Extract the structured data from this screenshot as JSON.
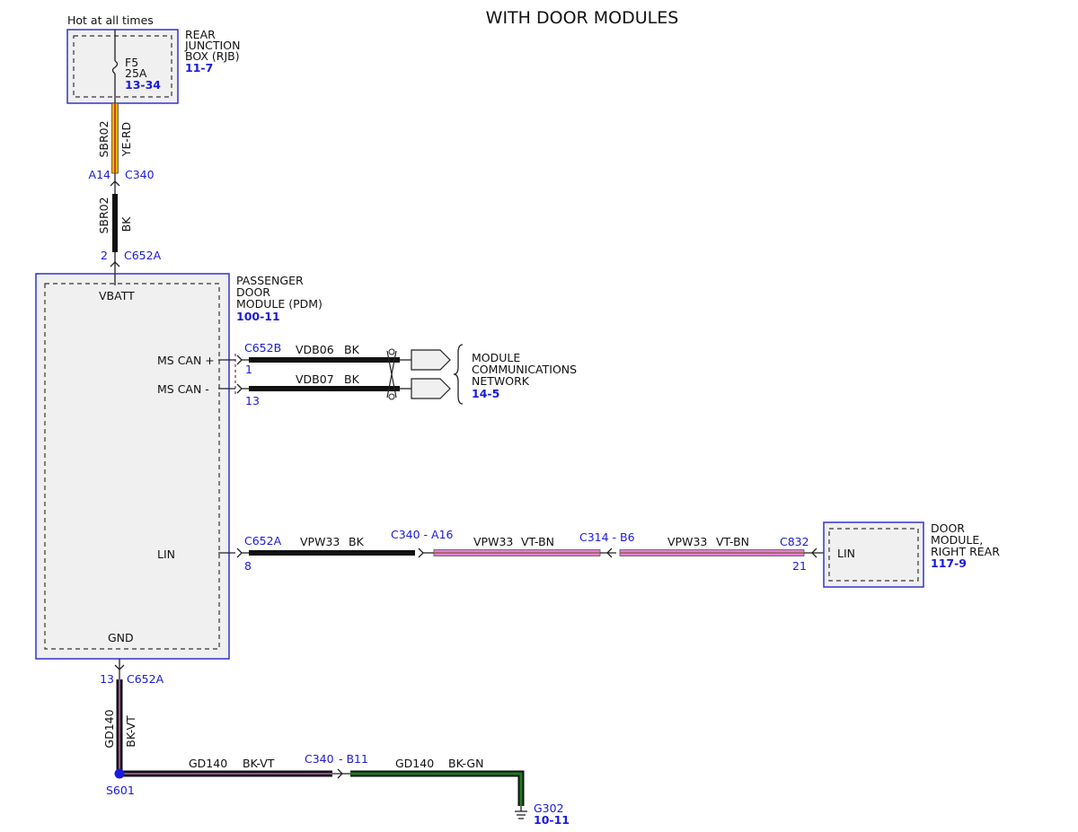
{
  "title": "WITH DOOR MODULES",
  "colors": {
    "box_border": "#3333cc",
    "link_text": "#1a1adb",
    "wire_bk": "#111111",
    "wire_ye_rd_base": "#f5b800",
    "wire_vt_bn": "#e080d8",
    "wire_bk_vt_core": "#c060c0",
    "wire_bk_gn": "#1e7a1e",
    "splice_dot": "#1a1adb"
  },
  "rjb": {
    "hot_label": "Hot at all times",
    "name_lines": [
      "REAR",
      "JUNCTION",
      "BOX (RJB)"
    ],
    "page_ref": "11-7",
    "fuse_name": "F5",
    "fuse_rating": "25A",
    "fuse_ref": "13-34"
  },
  "wire_top": {
    "circuit": "SBR02",
    "color": "YE-RD"
  },
  "conn_c340_top": {
    "pin": "A14",
    "name": "C340"
  },
  "wire_mid": {
    "circuit": "SBR02",
    "color": "BK"
  },
  "conn_c652a_top": {
    "pin": "2",
    "name": "C652A"
  },
  "pdm": {
    "name_lines": [
      "PASSENGER",
      "DOOR",
      "MODULE (PDM)"
    ],
    "page_ref": "100-11",
    "vbatt": "VBATT",
    "ms_can_plus": "MS CAN +",
    "ms_can_minus": "MS CAN -",
    "lin": "LIN",
    "gnd": "GND"
  },
  "can": {
    "connector": "C652B",
    "pin1": "1",
    "pin13": "13",
    "wire1_circuit": "VDB06",
    "wire1_color": "BK",
    "wire2_circuit": "VDB07",
    "wire2_color": "BK",
    "network_lines": [
      "MODULE",
      "COMMUNICATIONS",
      "NETWORK"
    ],
    "network_ref": "14-5"
  },
  "lin_path": {
    "conn_pdm": "C652A",
    "pin_pdm": "8",
    "seg1_circuit": "VPW33",
    "seg1_color": "BK",
    "conn_mid1": "C340 - A16",
    "seg2_circuit": "VPW33",
    "seg2_color": "VT-BN",
    "conn_mid2": "C314 - B6",
    "seg3_circuit": "VPW33",
    "seg3_color": "VT-BN",
    "conn_rr": "C832",
    "pin_rr": "21"
  },
  "door_rr": {
    "name_lines": [
      "DOOR",
      "MODULE,",
      "RIGHT REAR"
    ],
    "page_ref": "117-9",
    "lin": "LIN"
  },
  "ground_path": {
    "pin": "13",
    "conn": "C652A",
    "vert_circuit": "GD140",
    "vert_color": "BK-VT",
    "splice": "S601",
    "seg1_circuit": "GD140",
    "seg1_color": "BK-VT",
    "conn_mid": "C340",
    "conn_mid_pin": "- B11",
    "seg2_circuit": "GD140",
    "seg2_color": "BK-GN",
    "ground_name": "G302",
    "ground_ref": "10-11"
  }
}
